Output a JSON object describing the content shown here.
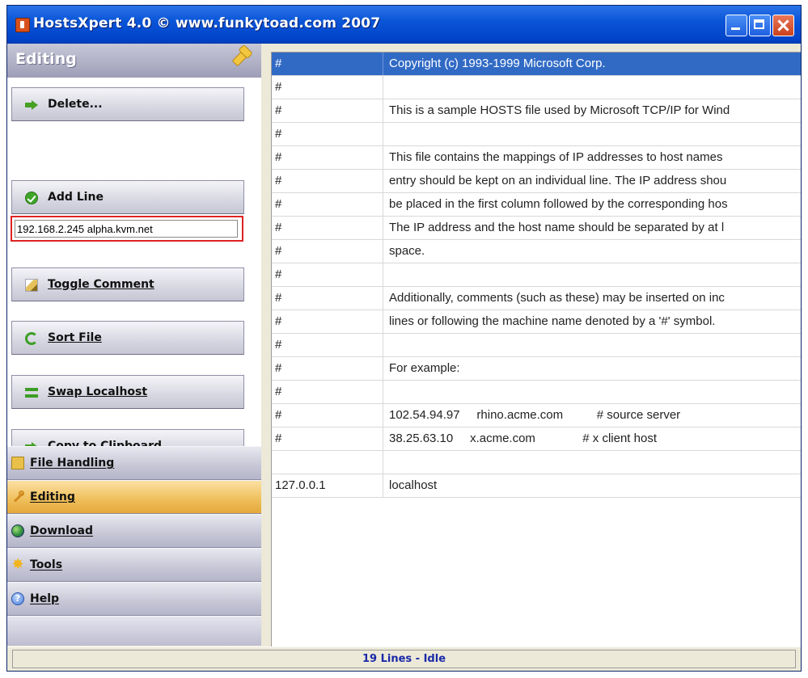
{
  "window": {
    "title": "HostsXpert 4.0 © www.funkytoad.com 2007",
    "controls": [
      "minimize",
      "maximize",
      "close"
    ]
  },
  "sidebar": {
    "panel_title": "Editing",
    "actions": [
      {
        "label": "Delete...",
        "icon": "green-arrow-icon"
      },
      {
        "label": "Add Line",
        "icon": "green-check-icon"
      },
      {
        "label": "Toggle Comment",
        "icon": "pencil-icon"
      },
      {
        "label": "Sort File",
        "icon": "sort-cycle-icon"
      },
      {
        "label": "Swap Localhost",
        "icon": "swap-arrows-icon"
      },
      {
        "label": "Copy to Clipboard...",
        "icon": "green-arrow-icon"
      }
    ],
    "add_line_value": "192.168.2.245 alpha.kvm.net",
    "nav": [
      {
        "label": "File Handling",
        "icon": "folder-icon",
        "active": false
      },
      {
        "label": "Editing",
        "icon": "wrench-icon",
        "active": true
      },
      {
        "label": "Download",
        "icon": "globe-icon",
        "active": false
      },
      {
        "label": "Tools",
        "icon": "star-icon",
        "active": false
      },
      {
        "label": "Help",
        "icon": "help-icon",
        "active": false
      }
    ]
  },
  "hosts": {
    "rows": [
      {
        "c1": "#",
        "c2": "Copyright (c) 1993-1999 Microsoft Corp.",
        "selected": true
      },
      {
        "c1": "#",
        "c2": ""
      },
      {
        "c1": "#",
        "c2": "This is a sample HOSTS file used by Microsoft TCP/IP for Wind"
      },
      {
        "c1": "#",
        "c2": ""
      },
      {
        "c1": "#",
        "c2": "This file contains the mappings of IP addresses to host names"
      },
      {
        "c1": "#",
        "c2": "entry should be kept on an individual line. The IP address shou"
      },
      {
        "c1": "#",
        "c2": "be placed in the first column followed by the corresponding hos"
      },
      {
        "c1": "#",
        "c2": "The IP address and the host name should be separated by at l"
      },
      {
        "c1": "#",
        "c2": "space."
      },
      {
        "c1": "#",
        "c2": ""
      },
      {
        "c1": "#",
        "c2": "Additionally, comments (such as these) may be inserted on inc"
      },
      {
        "c1": "#",
        "c2": "lines or following the machine name denoted by a '#' symbol."
      },
      {
        "c1": "#",
        "c2": ""
      },
      {
        "c1": "#",
        "c2": "For example:"
      },
      {
        "c1": "#",
        "c2": ""
      },
      {
        "c1": "#",
        "c2": "102.54.94.97     rhino.acme.com          # source server"
      },
      {
        "c1": "#",
        "c2": "38.25.63.10     x.acme.com              # x client host"
      },
      {
        "c1": "",
        "c2": ""
      },
      {
        "c1": "127.0.0.1",
        "c2": "localhost"
      }
    ]
  },
  "status": {
    "text": "19 Lines - Idle"
  },
  "colors": {
    "title_blue": "#0a55d8",
    "selection": "#316ac5",
    "status_text": "#1a2aa8",
    "active_nav": "#f0c15e",
    "highlight_border": "#dd2222"
  }
}
